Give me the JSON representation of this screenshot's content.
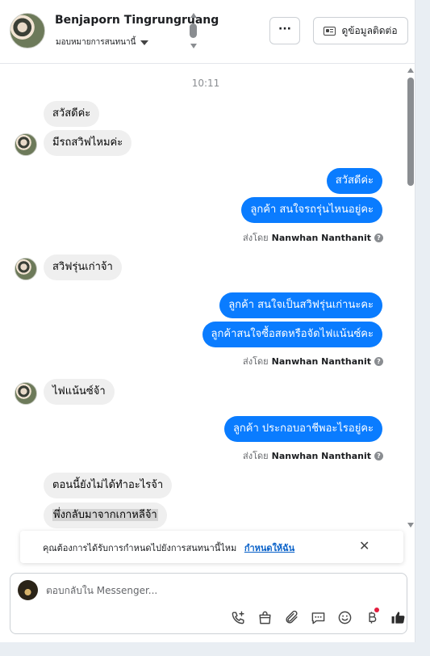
{
  "header": {
    "contact_name": "Benjaporn Tingrungruang",
    "assign_label": "มอบหมายการสนทนานี้",
    "more_label": "···",
    "view_contact_label": "ดูข้อมูลติดต่อ"
  },
  "chat": {
    "timestamp": "10:11",
    "messages": [
      {
        "from": "customer",
        "text": "สวัสดีค่ะ"
      },
      {
        "from": "customer",
        "text": "มีรถสวิฟไหมค่ะ"
      },
      {
        "from": "page",
        "text": "สวัสดีค่ะ"
      },
      {
        "from": "page",
        "text": "ลูกค้า สนใจรถรุ่นไหนอยู่คะ"
      },
      {
        "from": "customer",
        "text": "สวิฟรุ่นเก่าจ้า"
      },
      {
        "from": "page",
        "text": "ลูกค้า สนใจเป็นสวิฟรุ่นเก่านะคะ"
      },
      {
        "from": "page",
        "text": "ลูกค้าสนใจซื้อสดหรือจัดไฟแน้นซ์คะ"
      },
      {
        "from": "customer",
        "text": "ไฟแน้นซ์จ้า"
      },
      {
        "from": "page",
        "text": "ลูกค้า ประกอบอาชีพอะไรอยู่คะ"
      },
      {
        "from": "customer",
        "text": "ตอนนี้ยังไม่ได้ทำอะไรจ้า"
      },
      {
        "from": "customer",
        "text": "พึ่งกลับมาจากเกาหลีจ้า"
      }
    ],
    "sent_by_prefix": "ส่งโดย",
    "sent_by_name": "Nanwhan Nanthanit",
    "help_glyph": "?"
  },
  "notice": {
    "text": "คุณต้องการได้รับการกำหนดไปยังการสนทนานี้ไหม",
    "link": "กำหนดให้ฉัน",
    "close": "✕"
  },
  "composer": {
    "placeholder": "ตอบกลับใน Messenger..."
  },
  "colors": {
    "outgoing_bubble": "#0a7cff",
    "incoming_bubble": "#efefef",
    "link": "#0a62c9",
    "badge": "#e41e3f"
  },
  "icons": [
    "phone-plus-icon",
    "shopping-bag-icon",
    "paperclip-icon",
    "chat-bubble-icon",
    "smiley-icon",
    "baht-icon",
    "thumbs-up-icon"
  ]
}
